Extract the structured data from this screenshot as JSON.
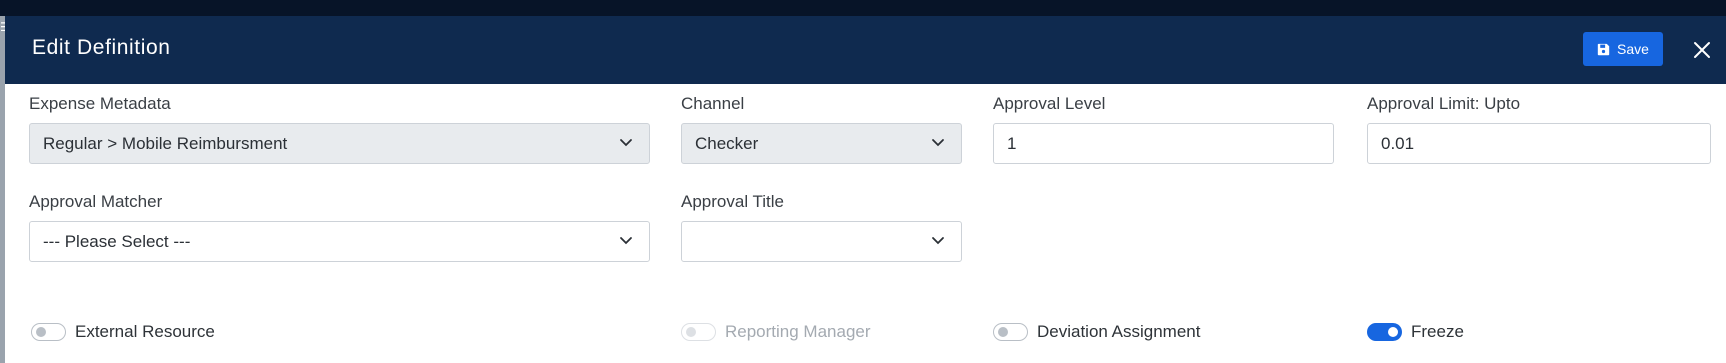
{
  "modal": {
    "title": "Edit Definition",
    "save_label": "Save"
  },
  "fields": {
    "expense_metadata": {
      "label": "Expense Metadata",
      "value": "Regular > Mobile Reimbursment"
    },
    "channel": {
      "label": "Channel",
      "value": "Checker"
    },
    "approval_level": {
      "label": "Approval Level",
      "value": "1"
    },
    "approval_limit": {
      "label": "Approval Limit: Upto",
      "value": "0.01"
    },
    "approval_matcher": {
      "label": "Approval Matcher",
      "value": "--- Please Select ---"
    },
    "approval_title": {
      "label": "Approval Title",
      "value": ""
    }
  },
  "toggles": {
    "external_resource": {
      "label": "External Resource",
      "on": false,
      "disabled": false
    },
    "reporting_manager": {
      "label": "Reporting Manager",
      "on": false,
      "disabled": true
    },
    "deviation_assignment": {
      "label": "Deviation Assignment",
      "on": false,
      "disabled": false
    },
    "freeze": {
      "label": "Freeze",
      "on": true,
      "disabled": false
    }
  },
  "colors": {
    "header_bg": "#0f2a4f",
    "accent": "#1766e0",
    "select_filled_bg": "#e8ebee"
  },
  "icons": {
    "save": "floppy-disk-icon",
    "close": "close-icon",
    "dropdown": "chevron-down-icon",
    "menu": "hamburger-icon"
  }
}
